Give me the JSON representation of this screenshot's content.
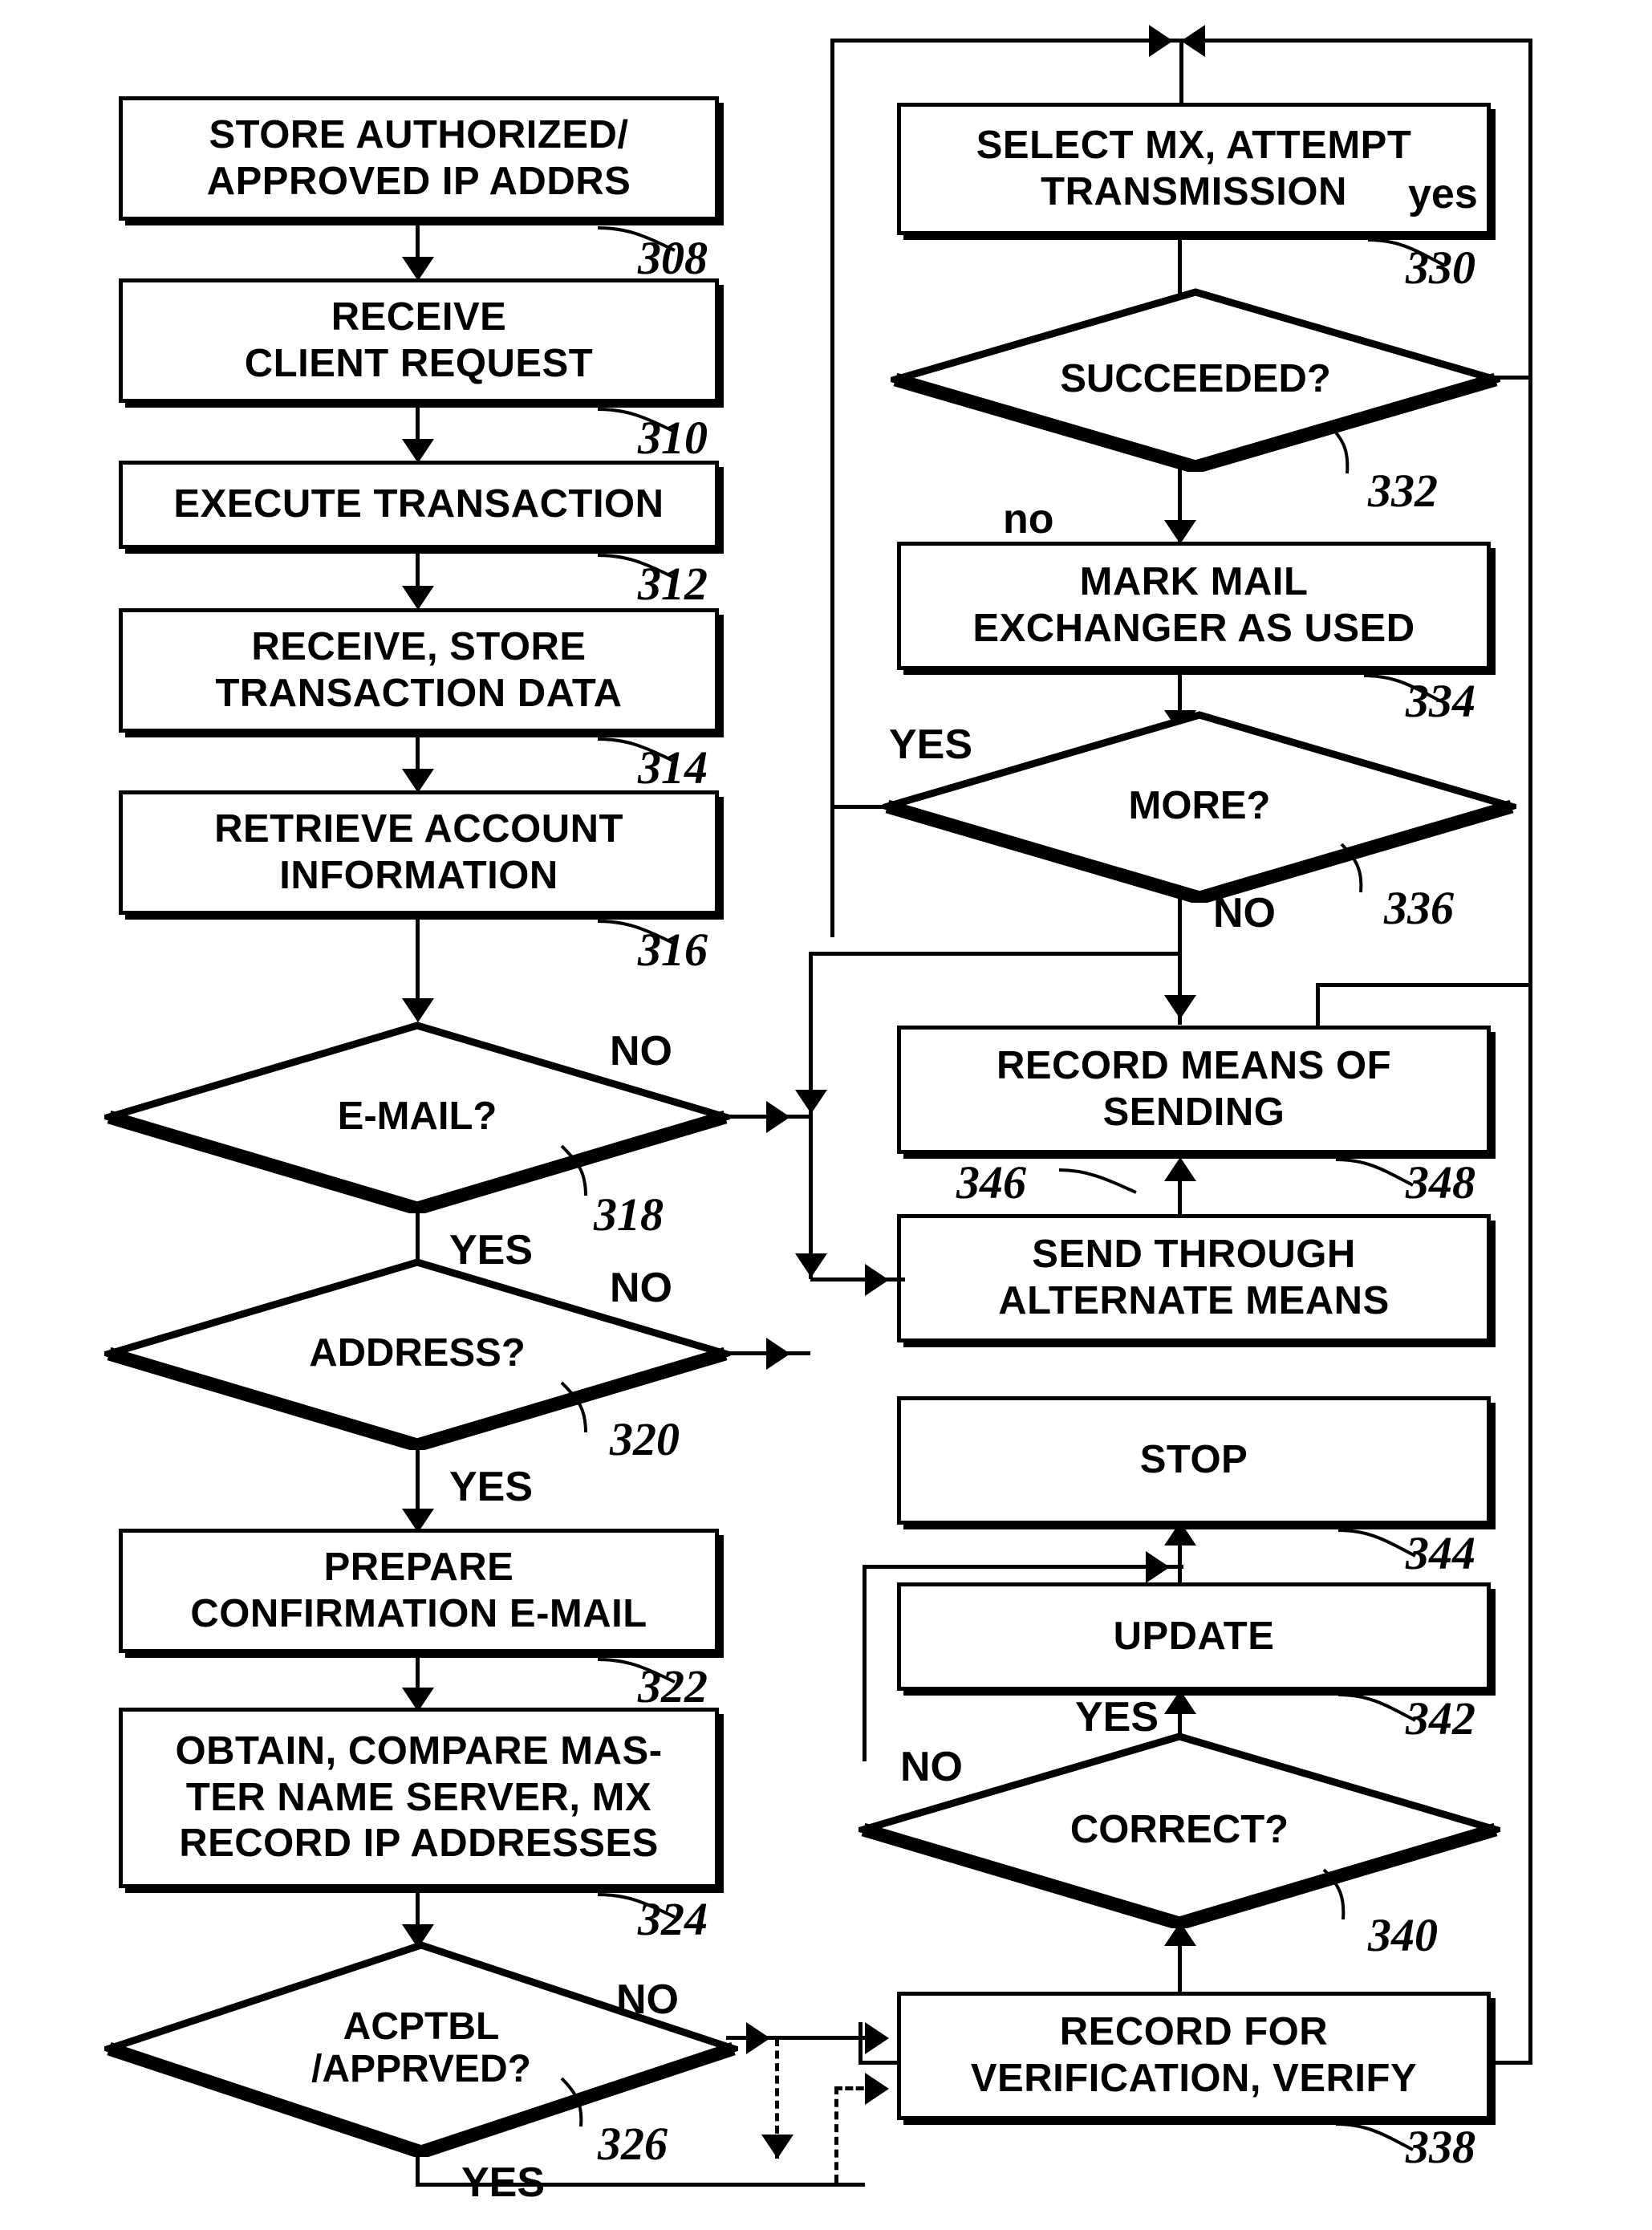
{
  "diagram": {
    "type": "flowchart",
    "title": "",
    "nodes": [
      {
        "id": "308",
        "shape": "process",
        "ref": "308",
        "lines": [
          "STORE AUTHORIZED/",
          "APPROVED IP ADDRS"
        ]
      },
      {
        "id": "310",
        "shape": "process",
        "ref": "310",
        "lines": [
          "RECEIVE",
          "CLIENT REQUEST"
        ]
      },
      {
        "id": "312",
        "shape": "process",
        "ref": "312",
        "lines": [
          "EXECUTE TRANSACTION"
        ]
      },
      {
        "id": "314",
        "shape": "process",
        "ref": "314",
        "lines": [
          "RECEIVE, STORE",
          "TRANSACTION DATA"
        ]
      },
      {
        "id": "316",
        "shape": "process",
        "ref": "316",
        "lines": [
          "RETRIEVE ACCOUNT",
          "INFORMATION"
        ]
      },
      {
        "id": "318",
        "shape": "decision",
        "ref": "318",
        "lines": [
          "E-MAIL?"
        ]
      },
      {
        "id": "320",
        "shape": "decision",
        "ref": "320",
        "lines": [
          "ADDRESS?"
        ]
      },
      {
        "id": "322",
        "shape": "process",
        "ref": "322",
        "lines": [
          "PREPARE",
          "CONFIRMATION E-MAIL"
        ]
      },
      {
        "id": "324",
        "shape": "process",
        "ref": "324",
        "lines": [
          "OBTAIN, COMPARE MAS-",
          "TER NAME SERVER, MX",
          "RECORD IP ADDRESSES"
        ]
      },
      {
        "id": "326",
        "shape": "decision",
        "ref": "326",
        "lines": [
          "ACPTBL",
          "/APPRVED?"
        ]
      },
      {
        "id": "330",
        "shape": "process",
        "ref": "330",
        "lines": [
          "SELECT MX, ATTEMPT",
          "TRANSMISSION"
        ]
      },
      {
        "id": "332",
        "shape": "decision",
        "ref": "332",
        "lines": [
          "SUCCEEDED?"
        ]
      },
      {
        "id": "334",
        "shape": "process",
        "ref": "334",
        "lines": [
          "MARK MAIL",
          "EXCHANGER AS USED"
        ]
      },
      {
        "id": "336",
        "shape": "decision",
        "ref": "336",
        "lines": [
          "MORE?"
        ]
      },
      {
        "id": "338",
        "shape": "process",
        "ref": "338",
        "lines": [
          "RECORD FOR",
          "VERIFICATION, VERIFY"
        ]
      },
      {
        "id": "340",
        "shape": "decision",
        "ref": "340",
        "lines": [
          "CORRECT?"
        ]
      },
      {
        "id": "342",
        "shape": "process",
        "ref": "342",
        "lines": [
          "UPDATE"
        ]
      },
      {
        "id": "344",
        "shape": "process",
        "ref": "344",
        "lines": [
          "STOP"
        ]
      },
      {
        "id": "346",
        "shape": "process",
        "ref": "346",
        "lines": [
          "SEND THROUGH",
          "ALTERNATE MEANS"
        ]
      },
      {
        "id": "348",
        "shape": "process",
        "ref": "348",
        "lines": [
          "RECORD MEANS OF",
          "SENDING"
        ]
      }
    ],
    "edge_labels": {
      "email_no": "NO",
      "email_yes": "YES",
      "address_no": "NO",
      "address_yes": "YES",
      "acptbl_no": "NO",
      "acptbl_yes": "YES",
      "succeeded_yes": "yes",
      "succeeded_no": "no",
      "more_yes": "YES",
      "more_no": "NO",
      "correct_yes": "YES",
      "correct_no": "NO"
    },
    "refs": {
      "r308": "308",
      "r310": "310",
      "r312": "312",
      "r314": "314",
      "r316": "316",
      "r318": "318",
      "r320": "320",
      "r322": "322",
      "r324": "324",
      "r326": "326",
      "r330": "330",
      "r332": "332",
      "r334": "334",
      "r336": "336",
      "r338": "338",
      "r340": "340",
      "r342": "342",
      "r344": "344",
      "r346": "346",
      "r348": "348"
    },
    "colors": {
      "ink": "#000000",
      "paper": "#ffffff"
    }
  }
}
